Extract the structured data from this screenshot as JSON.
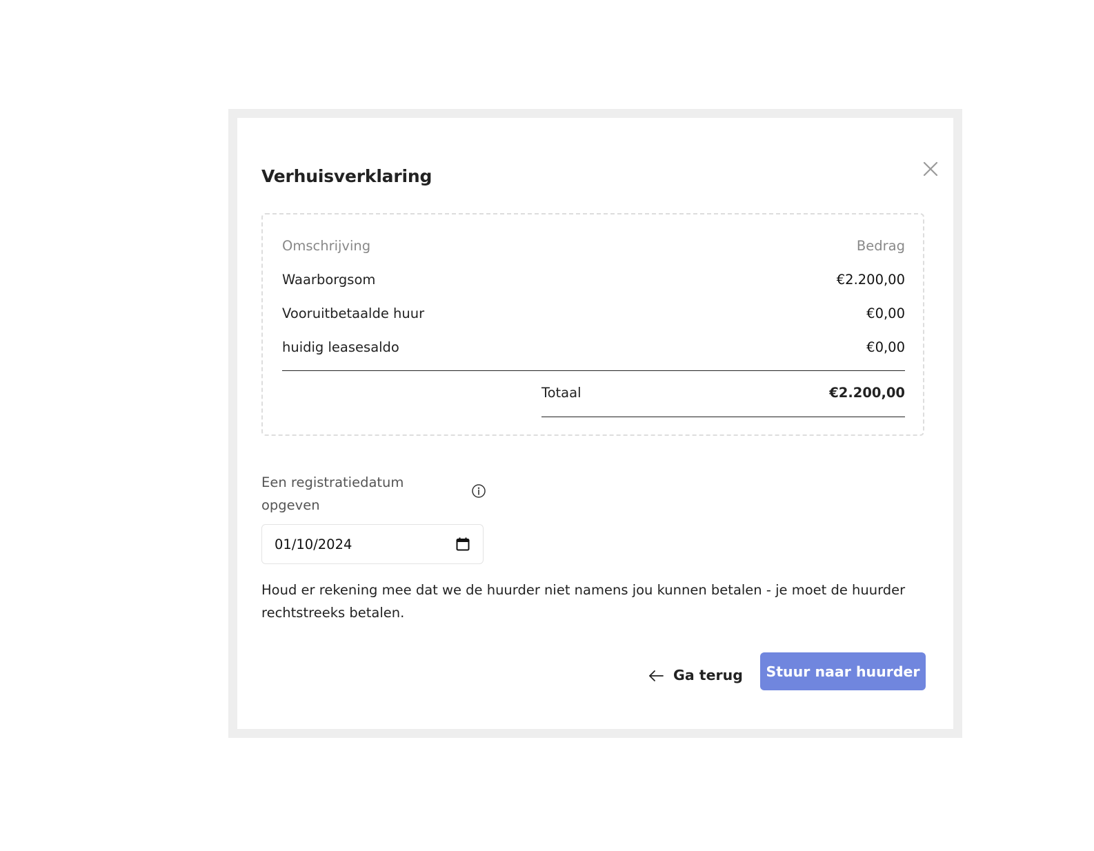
{
  "modal": {
    "title": "Verhuisverklaring"
  },
  "summary": {
    "header": {
      "description": "Omschrijving",
      "amount": "Bedrag"
    },
    "rows": [
      {
        "description": "Waarborgsom",
        "amount": "€2.200,00"
      },
      {
        "description": "Vooruitbetaalde huur",
        "amount": "€0,00"
      },
      {
        "description": "huidig leasesaldo",
        "amount": "€0,00"
      }
    ],
    "total": {
      "label": "Totaal",
      "amount": "€2.200,00"
    }
  },
  "registration": {
    "label": "Een registratiedatum opgeven",
    "date_value": "01/10/2024"
  },
  "note": "Houd er rekening mee dat we de huurder niet namens jou kunnen betalen - je moet de huurder rechtstreeks betalen.",
  "actions": {
    "back_label": "Ga terug",
    "send_label": "Stuur naar huurder"
  },
  "colors": {
    "primary": "#7086de",
    "frame": "#eeeeee"
  },
  "icons": [
    "close-icon",
    "info-icon",
    "calendar-icon",
    "arrow-left-icon"
  ]
}
